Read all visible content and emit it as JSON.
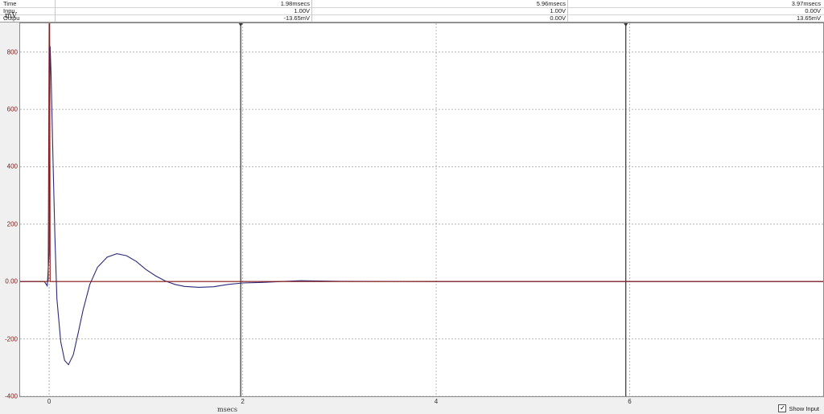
{
  "readout": {
    "rows": [
      {
        "label": "Time",
        "c1": "1.98msecs",
        "c2": "5.96msecs",
        "c3": "3.97msecs"
      },
      {
        "label": "Inpu",
        "c1": "1.00V",
        "c2": "1.00V",
        "c3": "0.00V"
      },
      {
        "label": "Outpu",
        "c1": "-13.65mV",
        "c2": "0.00V",
        "c3": "13.65mV"
      }
    ]
  },
  "unit_label": "mV",
  "show_input": {
    "label": "Show Input",
    "checked": true,
    "check_glyph": "✓"
  },
  "colors": {
    "output": "#2a2a7a",
    "input": "#8b1a1a",
    "grid": "#b4b4b4",
    "cursor": "#303030"
  },
  "chart_data": {
    "type": "line",
    "title": "",
    "xlabel": "msecs",
    "ylabel": "mV",
    "xlim": [
      -0.3,
      8.0
    ],
    "ylim": [
      -400,
      900
    ],
    "x_ticks": [
      0,
      2,
      4,
      6
    ],
    "x_tick_labels": [
      "0",
      "2",
      "4",
      "6"
    ],
    "y_ticks": [
      800,
      600,
      400,
      200,
      0,
      -200,
      -400
    ],
    "y_tick_labels": [
      "800",
      "600",
      "400",
      "200",
      "0.00",
      "-200",
      "-400"
    ],
    "grid": true,
    "cursors_x": [
      1.98,
      5.96
    ],
    "series": [
      {
        "name": "",
        "x": [
          -0.3,
          -0.05,
          -0.02,
          0.0,
          0.01,
          0.02,
          0.04,
          0.06,
          0.08,
          0.12,
          0.16,
          0.2,
          0.25,
          0.3,
          0.35,
          0.42,
          0.5,
          0.6,
          0.7,
          0.8,
          0.9,
          1.0,
          1.1,
          1.2,
          1.3,
          1.4,
          1.55,
          1.7,
          1.85,
          2.0,
          2.2,
          2.4,
          2.6,
          2.8,
          3.0,
          4.0,
          6.0,
          8.0
        ],
        "y": [
          0,
          0,
          -15,
          100,
          820,
          720,
          420,
          150,
          -60,
          -210,
          -275,
          -290,
          -255,
          -180,
          -100,
          -10,
          50,
          85,
          97,
          90,
          70,
          42,
          20,
          2,
          -10,
          -17,
          -20,
          -18,
          -10,
          -5,
          -3,
          0,
          3,
          2,
          1,
          0,
          0,
          0
        ]
      },
      {
        "name": "",
        "x": [
          -0.3,
          -0.01,
          0.0,
          0.005,
          0.01,
          0.02,
          8.0
        ],
        "y": [
          0,
          0,
          900,
          900,
          0,
          0,
          0
        ]
      }
    ]
  }
}
